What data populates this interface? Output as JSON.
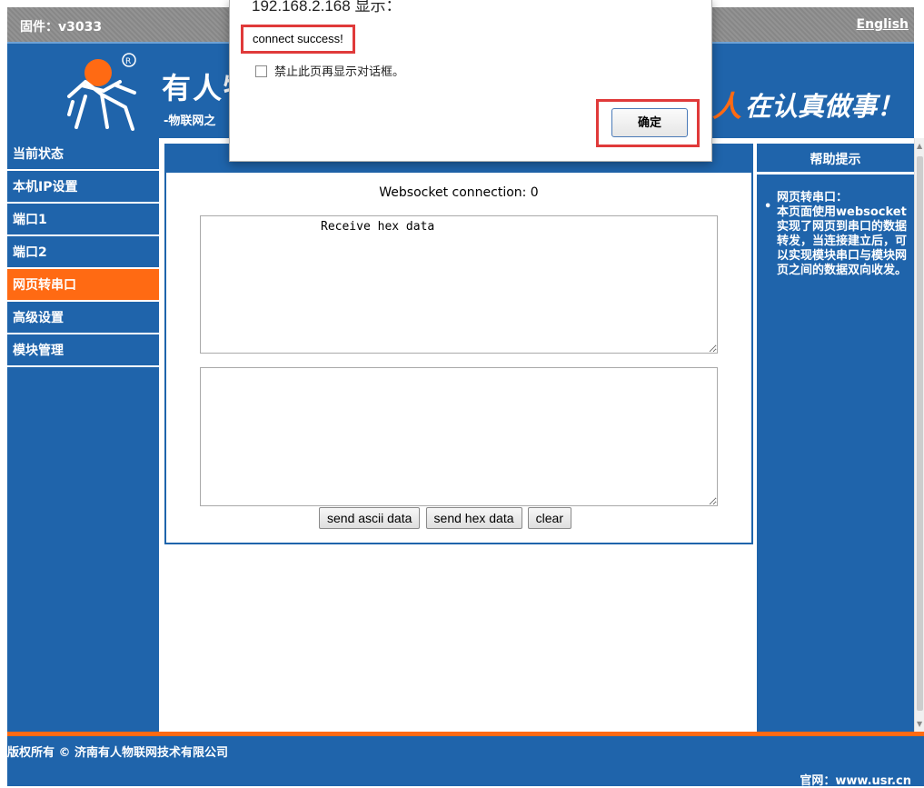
{
  "topbar": {
    "firmware": "固件：v3033",
    "language_link": "English"
  },
  "banner": {
    "brand": "有人物",
    "subtitle": "-物联网之",
    "slogan_accent": "人",
    "slogan": "在认真做事！"
  },
  "sidebar": {
    "items": [
      {
        "label": "当前状态",
        "active": false
      },
      {
        "label": "本机IP设置",
        "active": false
      },
      {
        "label": "端口1",
        "active": false
      },
      {
        "label": "端口2",
        "active": false
      },
      {
        "label": "网页转串口",
        "active": true
      },
      {
        "label": "高级设置",
        "active": false
      },
      {
        "label": "模块管理",
        "active": false
      }
    ]
  },
  "main": {
    "ws_status": "Websocket connection: 0",
    "receive_text": "Receive hex data",
    "send_text": "",
    "buttons": {
      "send_ascii": "send ascii data",
      "send_hex": "send hex data",
      "clear": "clear"
    }
  },
  "help": {
    "title": "帮助提示",
    "heading": "网页转串口：",
    "body": "本页面使用websocket实现了网页到串口的数据转发，当连接建立后，可以实现模块串口与模块网页之间的数据双向收发。"
  },
  "footer": {
    "copyright": "版权所有 © 济南有人物联网技术有限公司",
    "site": "官网：www.usr.cn"
  },
  "dialog": {
    "title": "192.168.2.168 显示：",
    "message": "connect success!",
    "checkbox_label": "禁止此页再显示对话框。",
    "ok_label": "确定"
  },
  "colors": {
    "primary": "#1f64ab",
    "accent": "#ff6a13",
    "highlight": "#e03a3a",
    "topbar": "#8c8c8c"
  }
}
